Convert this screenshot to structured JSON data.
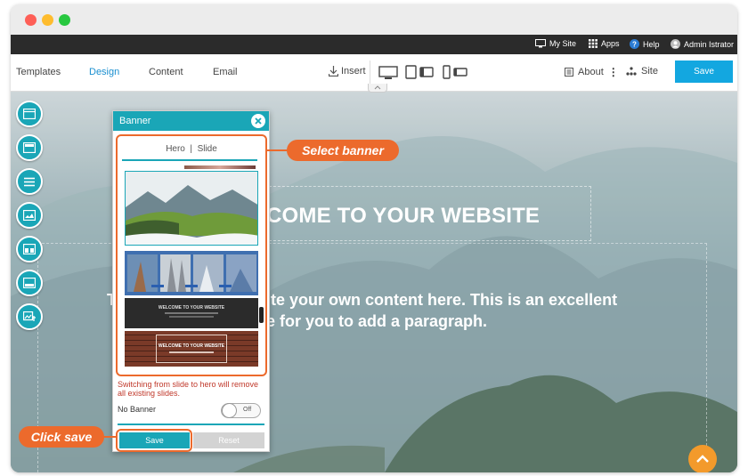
{
  "adminbar": {
    "my_site": "My Site",
    "apps": "Apps",
    "help": "Help",
    "user": "Admin Istrator"
  },
  "toolbar": {
    "tabs": [
      "Templates",
      "Design",
      "Content",
      "Email"
    ],
    "insert": "Insert",
    "about": "About",
    "site": "Site",
    "save": "Save"
  },
  "canvas": {
    "title": "COME TO YOUR WEBSITE",
    "para_line1": "ite your own content here. This is an excellent",
    "para_line2": "e for you to add a paragraph.",
    "para_fragment": "T"
  },
  "panel": {
    "title": "Banner",
    "tabs": "Hero  |  Slide",
    "thumb_caption_1": "WELCOME TO YOUR WEBSITE",
    "thumb_caption_2": "WELCOME TO YOUR WEBSITE",
    "warning": "Switching from slide to hero will remove all existing slides.",
    "no_banner_label": "No Banner",
    "toggle_label": "Off",
    "save": "Save",
    "reset": "Reset"
  },
  "callouts": {
    "select_banner": "Select banner",
    "click_save": "Click save"
  },
  "colors": {
    "accent": "#1aa6b7",
    "callout": "#ec6a2c",
    "toolbar_save": "#13a7e0",
    "adminbar": "#2b2b2b",
    "warning": "#c0392b"
  }
}
